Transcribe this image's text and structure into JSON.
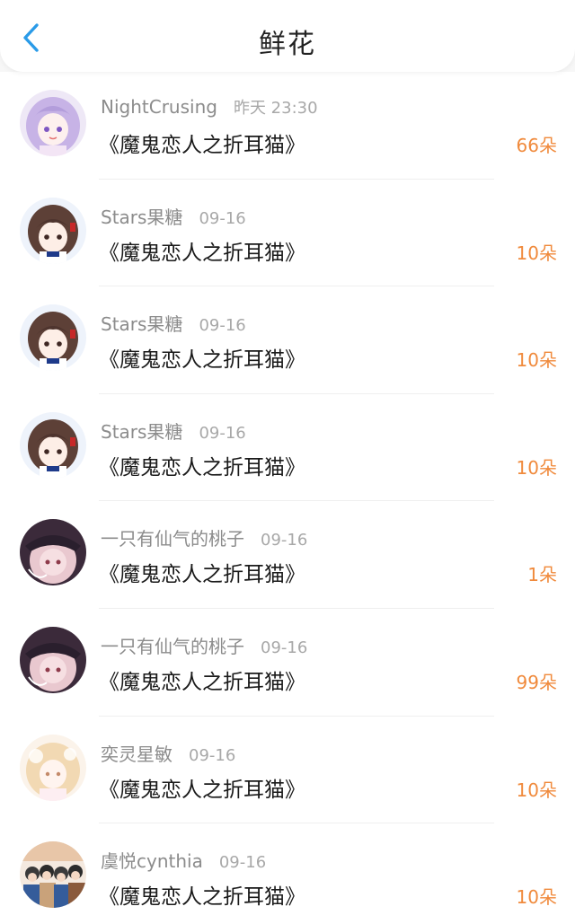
{
  "header": {
    "title": "鲜花",
    "back_icon": "chevron-left-icon",
    "accent_color": "#2a9be8"
  },
  "count_color": "#f08a3c",
  "rows": [
    {
      "user": "NightCrusing",
      "date": "昨天 23:30",
      "book": "《魔鬼恋人之折耳猫》",
      "count": "66朵",
      "avatar": "anime-girl-lavender"
    },
    {
      "user": "Stars果糖",
      "date": "09-16",
      "book": "《魔鬼恋人之折耳猫》",
      "count": "10朵",
      "avatar": "anime-girl-brown-hair"
    },
    {
      "user": "Stars果糖",
      "date": "09-16",
      "book": "《魔鬼恋人之折耳猫》",
      "count": "10朵",
      "avatar": "anime-girl-brown-hair"
    },
    {
      "user": "Stars果糖",
      "date": "09-16",
      "book": "《魔鬼恋人之折耳猫》",
      "count": "10朵",
      "avatar": "anime-girl-brown-hair"
    },
    {
      "user": "一只有仙气的桃子",
      "date": "09-16",
      "book": "《魔鬼恋人之折耳猫》",
      "count": "1朵",
      "avatar": "anime-girl-dark-hat"
    },
    {
      "user": "一只有仙气的桃子",
      "date": "09-16",
      "book": "《魔鬼恋人之折耳猫》",
      "count": "99朵",
      "avatar": "anime-girl-dark-hat"
    },
    {
      "user": "奕灵星敏",
      "date": "09-16",
      "book": "《魔鬼恋人之折耳猫》",
      "count": "10朵",
      "avatar": "anime-girl-blonde"
    },
    {
      "user": "虞悦cynthia",
      "date": "09-16",
      "book": "《魔鬼恋人之折耳猫》",
      "count": "10朵",
      "avatar": "group-photo"
    }
  ]
}
